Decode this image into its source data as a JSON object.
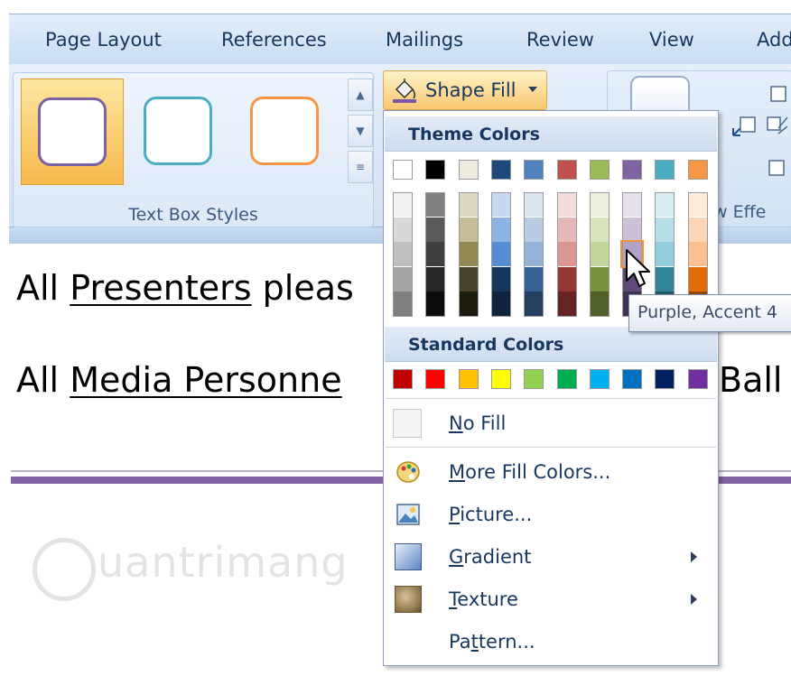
{
  "ribbon": {
    "tabs": [
      "Page Layout",
      "References",
      "Mailings",
      "Review",
      "View",
      "Add"
    ],
    "text_box_styles_label": "Text Box Styles",
    "shape_fill_label": "Shape Fill",
    "effects_label": "w Effe"
  },
  "document": {
    "line1": {
      "prefix": "All",
      "underlined": "Presenters",
      "rest": " pleas"
    },
    "line2": {
      "prefix": "All",
      "underlined": "Media Personne",
      "rest": "Ball"
    },
    "watermark": "uantrimang"
  },
  "dropdown": {
    "theme_colors_label": "Theme Colors",
    "standard_colors_label": "Standard Colors",
    "theme_base": [
      "#ffffff",
      "#000000",
      "#eeece1",
      "#1f497d",
      "#4f81bd",
      "#c0504d",
      "#9bbb59",
      "#8064a2",
      "#4bacc6",
      "#f79646"
    ],
    "theme_shades": [
      [
        "#f2f2f2",
        "#d8d8d8",
        "#bfbfbf",
        "#a5a5a5",
        "#7f7f7f"
      ],
      [
        "#7f7f7f",
        "#595959",
        "#3f3f3f",
        "#262626",
        "#0c0c0c"
      ],
      [
        "#ddd9c3",
        "#c4bd97",
        "#938953",
        "#494429",
        "#1d1b10"
      ],
      [
        "#c6d9f0",
        "#8db3e2",
        "#548dd4",
        "#17365d",
        "#0f243e"
      ],
      [
        "#dbe5f1",
        "#b8cce4",
        "#95b3d7",
        "#366092",
        "#244061"
      ],
      [
        "#f2dcdb",
        "#e5b9b7",
        "#d99694",
        "#953734",
        "#632423"
      ],
      [
        "#ebf1dd",
        "#d7e3bc",
        "#c3d69b",
        "#76923c",
        "#4f6128"
      ],
      [
        "#e5e0ec",
        "#ccc1d9",
        "#b2a2c7",
        "#5f497a",
        "#3f3151"
      ],
      [
        "#dbeef3",
        "#b7dde8",
        "#92cddc",
        "#31859b",
        "#205867"
      ],
      [
        "#fdeada",
        "#fbd5b5",
        "#fac08f",
        "#e36c09",
        "#974806"
      ]
    ],
    "standard": [
      "#c00000",
      "#ff0000",
      "#ffc000",
      "#ffff00",
      "#92d050",
      "#00b050",
      "#00b0f0",
      "#0070c0",
      "#002060",
      "#7030a0"
    ],
    "items": {
      "no_fill": {
        "accel": "N",
        "rest": "o Fill"
      },
      "more_colors": {
        "accel": "M",
        "rest": "ore Fill Colors..."
      },
      "picture": {
        "accel": "P",
        "rest": "icture..."
      },
      "gradient": {
        "accel": "G",
        "rest": "radient"
      },
      "texture": {
        "accel": "T",
        "rest": "exture"
      },
      "pattern": {
        "pre": "Pa",
        "accel": "t",
        "rest": "tern..."
      }
    }
  },
  "tooltip": "Purple, Accent 4"
}
